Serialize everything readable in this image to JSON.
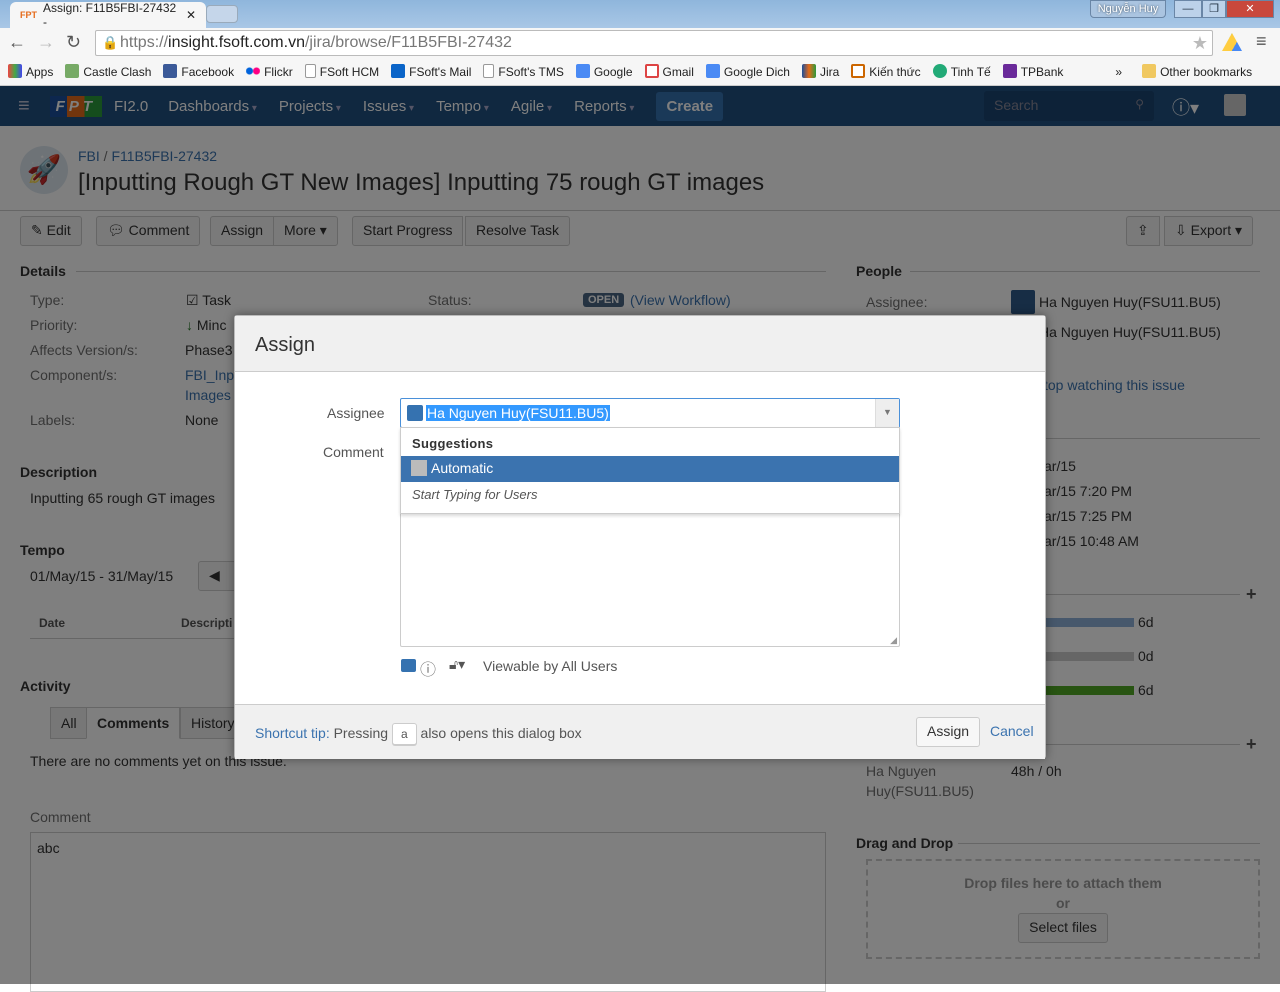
{
  "browser": {
    "tab_title": "Assign:  F11B5FBI-27432 -",
    "user_badge": "Nguyễn Huy",
    "url_prefix": "https://",
    "url_host": "insight.fsoft.com.vn",
    "url_path": "/jira/browse/F11B5FBI-27432",
    "bookmarks": [
      {
        "label": "Apps",
        "color": "#e44"
      },
      {
        "label": "Castle Clash",
        "color": "#7a6"
      },
      {
        "label": "Facebook",
        "color": "#3b5998"
      },
      {
        "label": "Flickr",
        "color": "#ff0084"
      },
      {
        "label": "FSoft HCM",
        "color": "#ddd"
      },
      {
        "label": "FSoft's Mail",
        "color": "#0a64c8"
      },
      {
        "label": "FSoft's TMS",
        "color": "#ddd"
      },
      {
        "label": "Google",
        "color": "#4a8af4"
      },
      {
        "label": "Gmail",
        "color": "#d44"
      },
      {
        "label": "Google Dich",
        "color": "#4a8af4"
      },
      {
        "label": "Jira",
        "color": "#e56a1a"
      },
      {
        "label": "Kiến thức",
        "color": "#c60"
      },
      {
        "label": "Tinh Tế",
        "color": "#2a7"
      },
      {
        "label": "TPBank",
        "color": "#6a2a9a"
      }
    ],
    "more_bookmarks": "»",
    "other_bookmarks": "Other bookmarks"
  },
  "nav": {
    "logo": "FPT",
    "project": "FI2.0",
    "items": [
      "Dashboards",
      "Projects",
      "Issues",
      "Tempo",
      "Agile",
      "Reports"
    ],
    "create": "Create",
    "search_placeholder": "Search"
  },
  "issue": {
    "breadcrumb_project": "FBI",
    "breadcrumb_sep": "/",
    "breadcrumb_key": "F11B5FBI-27432",
    "title": "[Inputting Rough GT New Images] Inputting 75 rough GT images",
    "toolbar": {
      "edit": "Edit",
      "comment": "Comment",
      "assign": "Assign",
      "more": "More",
      "start": "Start Progress",
      "resolve": "Resolve Task",
      "export": "Export"
    },
    "details_heading": "Details",
    "details": [
      {
        "label": "Type:",
        "value": "Task"
      },
      {
        "label": "Priority:",
        "value": "Minc"
      },
      {
        "label": "Affects Version/s:",
        "value": "Phase3"
      },
      {
        "label": "Component/s:",
        "value": "FBI_Inp"
      },
      {
        "label": "",
        "value": "Images"
      },
      {
        "label": "Labels:",
        "value": "None"
      }
    ],
    "status_label": "Status:",
    "status": "OPEN",
    "view_workflow": "(View Workflow)",
    "description_heading": "Description",
    "description": "Inputting 65 rough GT images",
    "tempo_heading": "Tempo",
    "tempo_range": "01/May/15 - 31/May/15",
    "tempo_cols": [
      "Date",
      "Descripti"
    ],
    "activity_heading": "Activity",
    "activity_tabs": [
      "All",
      "Comments",
      "History"
    ],
    "no_comments": "There are no comments yet on this issue.",
    "comment_label": "Comment",
    "comment_value": "abc",
    "people_heading": "People",
    "assignee_label": "Assignee:",
    "assignee": "Ha Nguyen Huy(FSU11.BU5)",
    "reporter": "Ha Nguyen Huy(FSU11.BU5)",
    "watch": "top watching this issue",
    "dates": [
      "ar/15",
      "ar/15 7:20 PM",
      "ar/15 7:25 PM",
      "ar/15 10:48 AM"
    ],
    "time_tracking": [
      {
        "value": "6d",
        "color": "#8eb0d8",
        "fill": 1.0
      },
      {
        "value": "0d",
        "color": "#ccc",
        "fill": 1.0
      },
      {
        "value": "6d",
        "color": "#51a825",
        "fill": 1.0
      }
    ],
    "worklog_user_1": "Ha Nguyen",
    "worklog_user_2": "Huy(FSU11.BU5)",
    "worklog_hours": "48h / 0h",
    "dnd_heading": "Drag and Drop",
    "dnd_text": "Drop files here to attach them",
    "dnd_or": "or",
    "select_files": "Select files"
  },
  "dialog": {
    "title": "Assign",
    "assignee_label": "Assignee",
    "assignee_value": "Ha Nguyen Huy(FSU11.BU5)",
    "comment_label": "Comment",
    "suggestions_heading": "Suggestions",
    "suggestion_selected": "Automatic",
    "suggestion_hint": "Start Typing for Users",
    "visibility": "Viewable by All Users",
    "shortcut_tip": "Shortcut tip:",
    "shortcut_pressing": "Pressing",
    "shortcut_key": "a",
    "shortcut_rest": "also opens this dialog box",
    "assign_button": "Assign",
    "cancel": "Cancel"
  }
}
